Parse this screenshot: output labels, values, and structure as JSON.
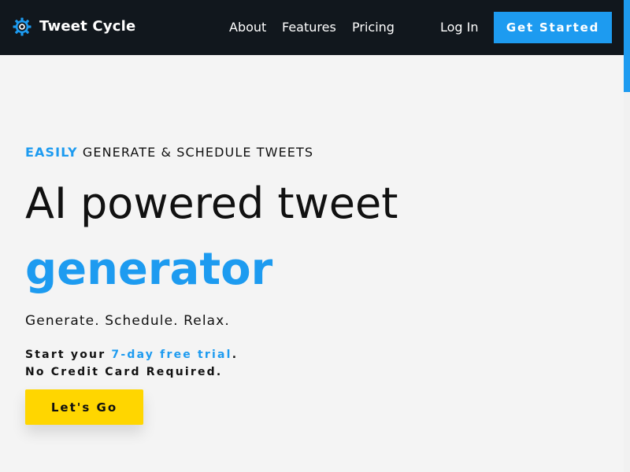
{
  "brand": {
    "name": "Tweet Cycle",
    "logo_icon": "gear-icon"
  },
  "nav": {
    "about": "About",
    "features": "Features",
    "pricing": "Pricing",
    "login": "Log In",
    "get_started": "Get Started"
  },
  "hero": {
    "eyebrow_accent": "EASILY",
    "eyebrow_rest": "GENERATE & SCHEDULE TWEETS",
    "headline": "AI powered tweet",
    "headline_accent": "generator",
    "tagline": "Generate. Schedule. Relax.",
    "trial_prefix": "Start your ",
    "trial_accent": "7-day free trial",
    "trial_suffix": ".",
    "no_credit_card": "No Credit Card Required.",
    "cta": "Let's Go"
  },
  "colors": {
    "accent": "#1d9bf0",
    "nav_bg": "#11171d",
    "cta_bg": "#ffd600",
    "page_bg": "#f4f4f4"
  }
}
